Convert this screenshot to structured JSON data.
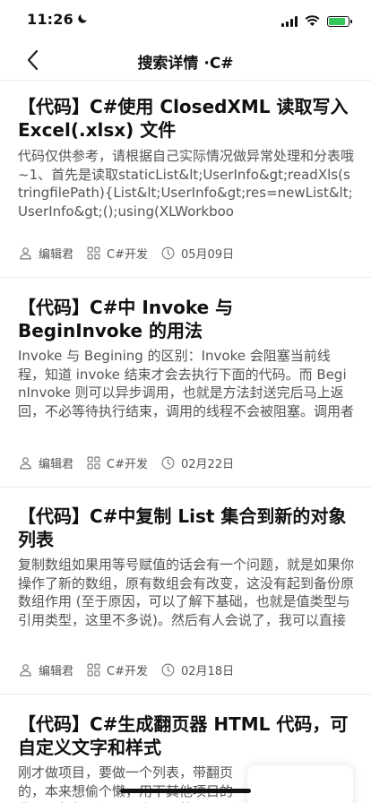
{
  "status_bar": {
    "time": "11:26",
    "battery_level": 0.85,
    "battery_color": "#35c759"
  },
  "nav": {
    "title": "搜索详情 ·C#"
  },
  "articles": [
    {
      "title": "【代码】C#使用 ClosedXML 读取写入Excel(.xlsx) 文件",
      "summary": "代码仅供参考，请根据自己实际情况做异常处理和分表哦~1、首先是读取staticList&lt;UserInfo&gt;readXls(stringfilePath){List&lt;UserInfo&gt;res=newList&lt;UserInfo&gt;();using(XLWorkboo",
      "author": "编辑君",
      "category": "C#开发",
      "date": "05月09日"
    },
    {
      "title": "【代码】C#中 Invoke 与 BeginInvoke 的用法",
      "summary": "Invoke 与 Begining 的区别：Invoke 会阻塞当前线程，知道 invoke 结束才会去执行下面的代码。而 BeginInvoke 则可以异步调用，也就是方法封送完后马上返回，不必等待执行结束，调用的线程不会被阻塞。调用者可以使用 EndInvoke 或者其它类似 WaitHandle 机制等待异步…",
      "author": "编辑君",
      "category": "C#开发",
      "date": "02月22日"
    },
    {
      "title": "【代码】C#中复制 List 集合到新的对象列表",
      "summary": "复制数组如果用等号赋值的话会有一个问题，就是如果你操作了新的数组，原有数组会有改变，这没有起到备份原数组作用 (至于原因，可以了解下基础，也就是值类型与引用类型，这里不多说)。然后有人会说了，我可以直接创建一个新的数组，按原来的一个一个插入，…",
      "author": "编辑君",
      "category": "C#开发",
      "date": "02月18日"
    },
    {
      "title": "【代码】C#生成翻页器 HTML 代码，可自定义文字和样式",
      "summary": "刚才做项目，要做一个列表，带翻页的，本来想偷个懒，用下其他项目的代码，想想，还是写个通用的",
      "author": "",
      "category": "",
      "date": ""
    }
  ]
}
